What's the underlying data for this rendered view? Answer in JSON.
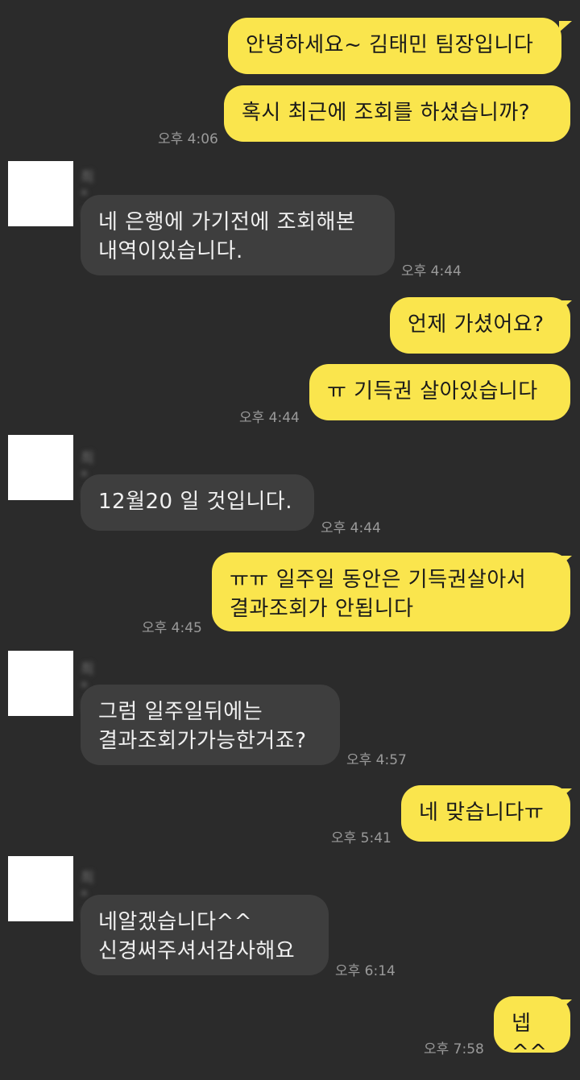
{
  "messages": [
    {
      "text": "안녕하세요~ 김태민 팀장입니다"
    },
    {
      "text": "혹시 최근에 조회를 하셨습니까?",
      "time": "오후 4:06"
    },
    {
      "sender": "최*진",
      "text": "네 은행에 가기전에 조회해본\n내역이있습니다.",
      "time": "오후 4:44"
    },
    {
      "text": "언제 가셨어요?"
    },
    {
      "text": "ㅠ 기득권 살아있습니다",
      "time": "오후 4:44"
    },
    {
      "sender": "최*진",
      "text": "12월20 일 것입니다.",
      "time": "오후 4:44"
    },
    {
      "text": "ㅠㅠ 일주일 동안은 기득권살아서\n결과조회가 안됩니다",
      "time": "오후 4:45"
    },
    {
      "sender": "최*진",
      "text": "그럼 일주일뒤에는\n결과조회가가능한거죠?",
      "time": "오후 4:57"
    },
    {
      "text": "네 맞습니다ㅠ",
      "time": "오후 5:41"
    },
    {
      "sender": "최*진",
      "text": "네알겠습니다^^\n신경써주셔서감사해요",
      "time": "오후 6:14"
    },
    {
      "text": "넵^^",
      "time": "오후 7:58"
    }
  ]
}
